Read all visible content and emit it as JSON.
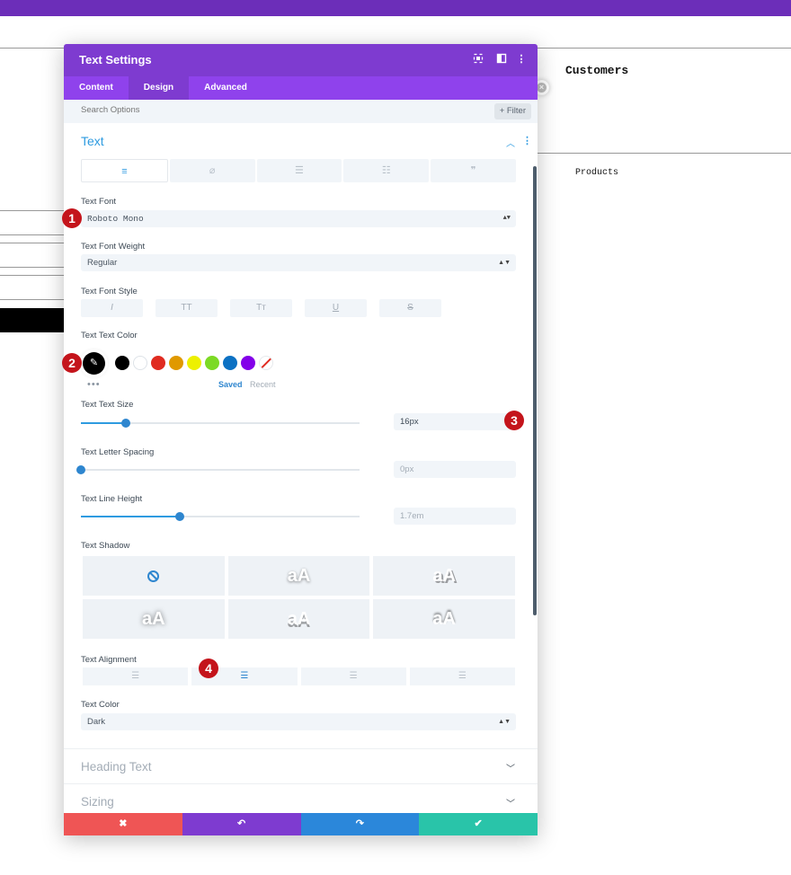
{
  "background": {
    "heading": "Customers",
    "subtext": "Products"
  },
  "modal": {
    "title": "Text Settings",
    "header_icons": [
      "focus-icon",
      "split-view-icon",
      "more-vertical-icon"
    ],
    "tabs": [
      "Content",
      "Design",
      "Advanced"
    ],
    "active_tab": "Design",
    "search_placeholder": "Search Options",
    "filter_label": "+ Filter",
    "section_text": {
      "title": "Text",
      "subtabs": [
        "align-left-icon",
        "link-icon",
        "unordered-list-icon",
        "ordered-list-icon",
        "quote-icon"
      ],
      "font": {
        "label": "Text Font",
        "value": "Roboto Mono"
      },
      "weight": {
        "label": "Text Font Weight",
        "value": "Regular"
      },
      "style": {
        "label": "Text Font Style",
        "options": [
          "I",
          "TT",
          "Tт",
          "U",
          "S"
        ]
      },
      "color": {
        "label": "Text Text Color",
        "swatches": [
          "#000000",
          "#ffffff",
          "#e02b20",
          "#e09900",
          "#edf000",
          "#7cda24",
          "#0c71c3",
          "#8300e9"
        ],
        "saved_label": "Saved",
        "recent_label": "Recent",
        "dots": "•••"
      },
      "size": {
        "label": "Text Text Size",
        "value": "16px",
        "level": 0.16
      },
      "letter_spacing": {
        "label": "Text Letter Spacing",
        "value": "0px",
        "level": 0.0
      },
      "line_height": {
        "label": "Text Line Height",
        "value": "1.7em",
        "level": 0.355
      },
      "shadow": {
        "label": "Text Shadow",
        "sample": "aA"
      },
      "alignment": {
        "label": "Text Alignment",
        "active_index": 1
      },
      "text_color": {
        "label": "Text Color",
        "value": "Dark"
      }
    },
    "section_heading": {
      "title": "Heading Text"
    },
    "section_sizing": {
      "title": "Sizing"
    },
    "footer": {
      "cancel": "✖",
      "undo": "↶",
      "redo": "↷",
      "save": "✔",
      "colors": [
        "#ef5555",
        "#7e3bd0",
        "#2b87da",
        "#29c4a9"
      ]
    }
  },
  "markers": [
    "1",
    "2",
    "3",
    "4"
  ]
}
